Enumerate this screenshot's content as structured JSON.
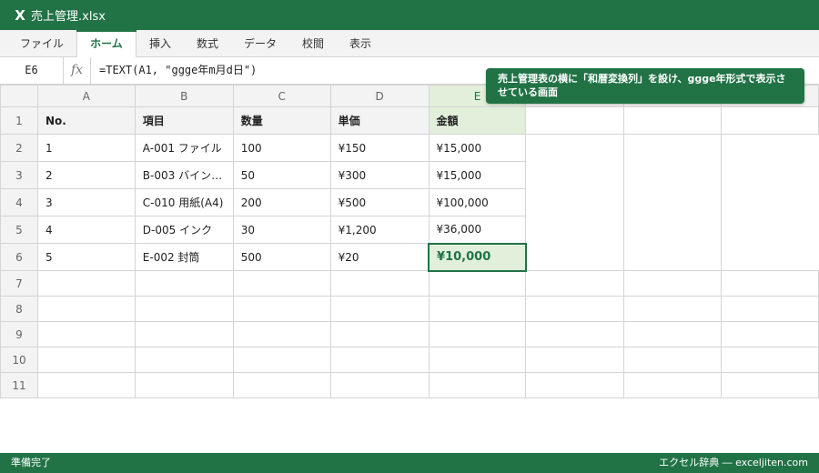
{
  "app": {
    "icon_letter": "X",
    "title": "売上管理.xlsx"
  },
  "ribbon": {
    "tabs": [
      "ファイル",
      "ホーム",
      "挿入",
      "数式",
      "データ",
      "校閲",
      "表示"
    ],
    "active_tab": "ホーム"
  },
  "formula_bar": {
    "name_box": "E6",
    "fx_label": "fx",
    "formula": "=TEXT(A1, \"ggge年m月d日\")"
  },
  "callout": {
    "text": "売上管理表の横に「和暦変換列」を設け、ggge年形式で表示させている画面"
  },
  "sheet": {
    "columns": [
      "A",
      "B",
      "C",
      "D",
      "E",
      "",
      "",
      ""
    ],
    "selected_column": "E",
    "selected_cell": "E6",
    "rows": [
      {
        "num": "1",
        "cells": [
          "No.",
          "項目",
          "数量",
          "単価",
          "金額"
        ]
      },
      {
        "num": "2",
        "cells": [
          "1",
          "A-001 ファイル",
          "100",
          "¥150",
          "¥15,000"
        ]
      },
      {
        "num": "3",
        "cells": [
          "2",
          "B-003 バイン…",
          "50",
          "¥300",
          "¥15,000"
        ]
      },
      {
        "num": "4",
        "cells": [
          "3",
          "C-010 用紙(A4)",
          "200",
          "¥500",
          "¥100,000"
        ]
      },
      {
        "num": "5",
        "cells": [
          "4",
          "D-005 インク",
          "30",
          "¥1,200",
          "¥36,000"
        ]
      },
      {
        "num": "6",
        "cells": [
          "5",
          "E-002 封筒",
          "500",
          "¥20",
          "¥10,000"
        ]
      },
      {
        "num": "7",
        "cells": []
      },
      {
        "num": "8",
        "cells": []
      },
      {
        "num": "9",
        "cells": []
      },
      {
        "num": "10",
        "cells": []
      },
      {
        "num": "11",
        "cells": []
      }
    ]
  },
  "status": {
    "left": "準備完了",
    "right": "エクセル辞典 ― exceljiten.com"
  },
  "colors": {
    "accent": "#217346",
    "selection_fill": "#e2efda",
    "header_fill": "#f3f3f3",
    "gridline": "#d4d4d4"
  }
}
